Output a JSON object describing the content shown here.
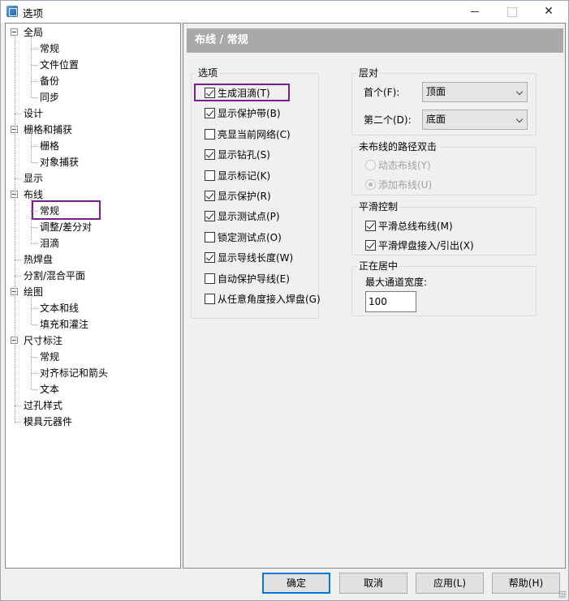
{
  "window": {
    "title": "选项"
  },
  "tree": {
    "items": [
      {
        "label": "全局",
        "level": 0,
        "expandable": true
      },
      {
        "label": "常规",
        "level": 1
      },
      {
        "label": "文件位置",
        "level": 1
      },
      {
        "label": "备份",
        "level": 1
      },
      {
        "label": "同步",
        "level": 1
      },
      {
        "label": "设计",
        "level": 0
      },
      {
        "label": "栅格和捕获",
        "level": 0,
        "expandable": true
      },
      {
        "label": "栅格",
        "level": 1
      },
      {
        "label": "对象捕获",
        "level": 1
      },
      {
        "label": "显示",
        "level": 0
      },
      {
        "label": "布线",
        "level": 0,
        "expandable": true
      },
      {
        "label": "常规",
        "level": 1,
        "selected": true
      },
      {
        "label": "调整/差分对",
        "level": 1
      },
      {
        "label": "泪滴",
        "level": 1
      },
      {
        "label": "热焊盘",
        "level": 0
      },
      {
        "label": "分割/混合平面",
        "level": 0
      },
      {
        "label": "绘图",
        "level": 0,
        "expandable": true
      },
      {
        "label": "文本和线",
        "level": 1
      },
      {
        "label": "填充和灌注",
        "level": 1
      },
      {
        "label": "尺寸标注",
        "level": 0,
        "expandable": true
      },
      {
        "label": "常规",
        "level": 1
      },
      {
        "label": "对齐标记和箭头",
        "level": 1
      },
      {
        "label": "文本",
        "level": 1
      },
      {
        "label": "过孔样式",
        "level": 0
      },
      {
        "label": "模具元器件",
        "level": 0
      }
    ]
  },
  "panel": {
    "header": "布线 / 常规",
    "options_group": {
      "legend": "选项",
      "items": [
        {
          "label": "生成泪滴(T)",
          "checked": true
        },
        {
          "label": "显示保护带(B)",
          "checked": true
        },
        {
          "label": "亮显当前网络(C)",
          "checked": false
        },
        {
          "label": "显示钻孔(S)",
          "checked": true
        },
        {
          "label": "显示标记(K)",
          "checked": false
        },
        {
          "label": "显示保护(R)",
          "checked": true
        },
        {
          "label": "显示测试点(P)",
          "checked": true
        },
        {
          "label": "锁定测试点(O)",
          "checked": false
        },
        {
          "label": "显示导线长度(W)",
          "checked": true
        },
        {
          "label": "自动保护导线(E)",
          "checked": false
        },
        {
          "label": "从任意角度接入焊盘(G)",
          "checked": false
        }
      ]
    },
    "layer_pair": {
      "legend": "层对",
      "first_label": "首个(F):",
      "first_value": "顶面",
      "second_label": "第二个(D):",
      "second_value": "底面"
    },
    "unrouted_path": {
      "legend": "未布线的路径双击",
      "dynamic": "动态布线(Y)",
      "add": "添加布线(U)"
    },
    "smoothing": {
      "legend": "平滑控制",
      "bus": "平滑总线布线(M)",
      "pad": "平滑焊盘接入/引出(X)"
    },
    "centering": {
      "legend": "正在居中",
      "max_width_label": "最大通道宽度:",
      "max_width_value": "100"
    }
  },
  "buttons": {
    "ok": "确定",
    "cancel": "取消",
    "apply": "应用(L)",
    "help": "帮助(H)"
  }
}
